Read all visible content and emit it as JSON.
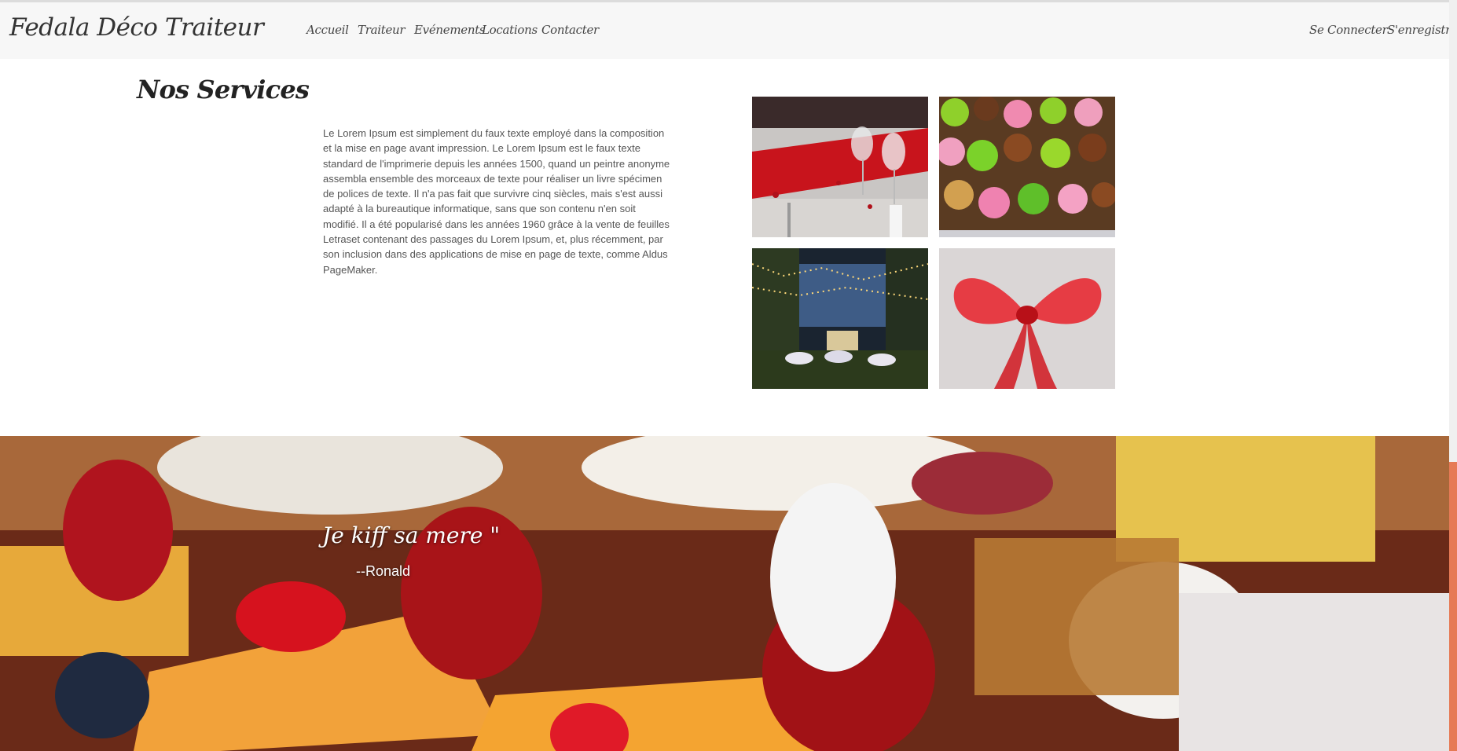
{
  "header": {
    "brand": "Fedala Déco Traiteur",
    "nav": [
      {
        "label": "Accueil"
      },
      {
        "label": "Traiteur"
      },
      {
        "label": "Evénements"
      },
      {
        "label": "Locations"
      },
      {
        "label": "Contacter"
      }
    ],
    "account": {
      "login": "Se Connecter",
      "register": "S'enregistrer"
    }
  },
  "services": {
    "title": "Nos Services",
    "body": "Le Lorem Ipsum est simplement du faux texte employé dans la composition et la mise en page avant impression. Le Lorem Ipsum est le faux texte standard de l'imprimerie depuis les années 1500, quand un peintre anonyme assembla ensemble des morceaux de texte pour réaliser un livre spécimen de polices de texte. Il n'a pas fait que survivre cinq siècles, mais s'est aussi adapté à la bureautique informatique, sans que son contenu n'en soit modifié. Il a été popularisé dans les années 1960 grâce à la vente de feuilles Letraset contenant des passages du Lorem Ipsum, et, plus récemment, par son inclusion dans des applications de mise en page de texte, comme Aldus PageMaker."
  },
  "gallery": [
    {
      "subject": "table-setting-photo"
    },
    {
      "subject": "cupcakes-photo"
    },
    {
      "subject": "garden-lights-photo"
    },
    {
      "subject": "red-ribbon-photo"
    }
  ],
  "testimonial": {
    "quote": "Je kiff sa mere \"",
    "author": "--Ronald"
  },
  "colors": {
    "nav_bg": "#f7f7f7",
    "scroll_thumb": "#e67a55"
  }
}
